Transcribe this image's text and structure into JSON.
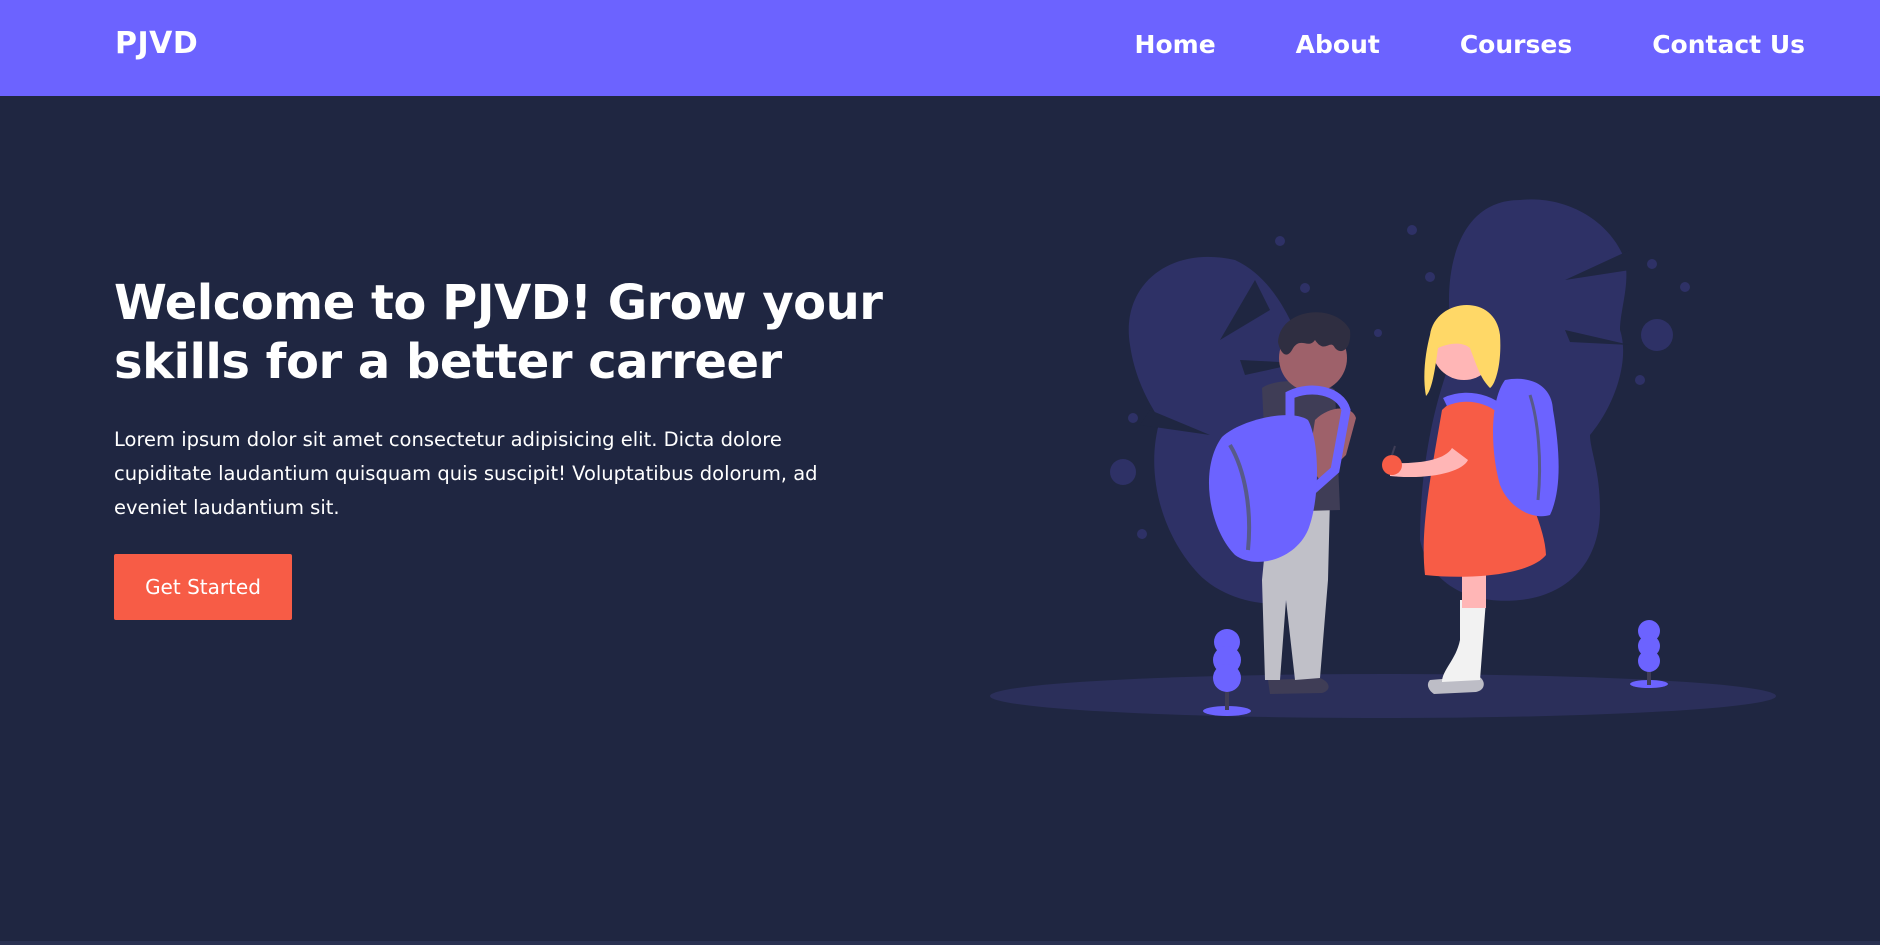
{
  "navbar": {
    "brand": "PJVD",
    "links": [
      "Home",
      "About",
      "Courses",
      "Contact Us"
    ]
  },
  "hero": {
    "title": "Welcome to PJVD! Grow your skills for a better carreer",
    "body": "Lorem ipsum dolor sit amet consectetur adipisicing elit. Dicta dolore cupiditate laudantium quisquam quis suscipit! Voluptatibus dolorum, ad eveniet laudantium sit.",
    "cta_label": "Get Started"
  },
  "colors": {
    "navbar": "#6c63ff",
    "background": "#1f2641",
    "cta": "#f75c46",
    "illustration_shape": "#2e3166"
  },
  "illustration": {
    "semantic": "two-students-with-backpacks"
  }
}
